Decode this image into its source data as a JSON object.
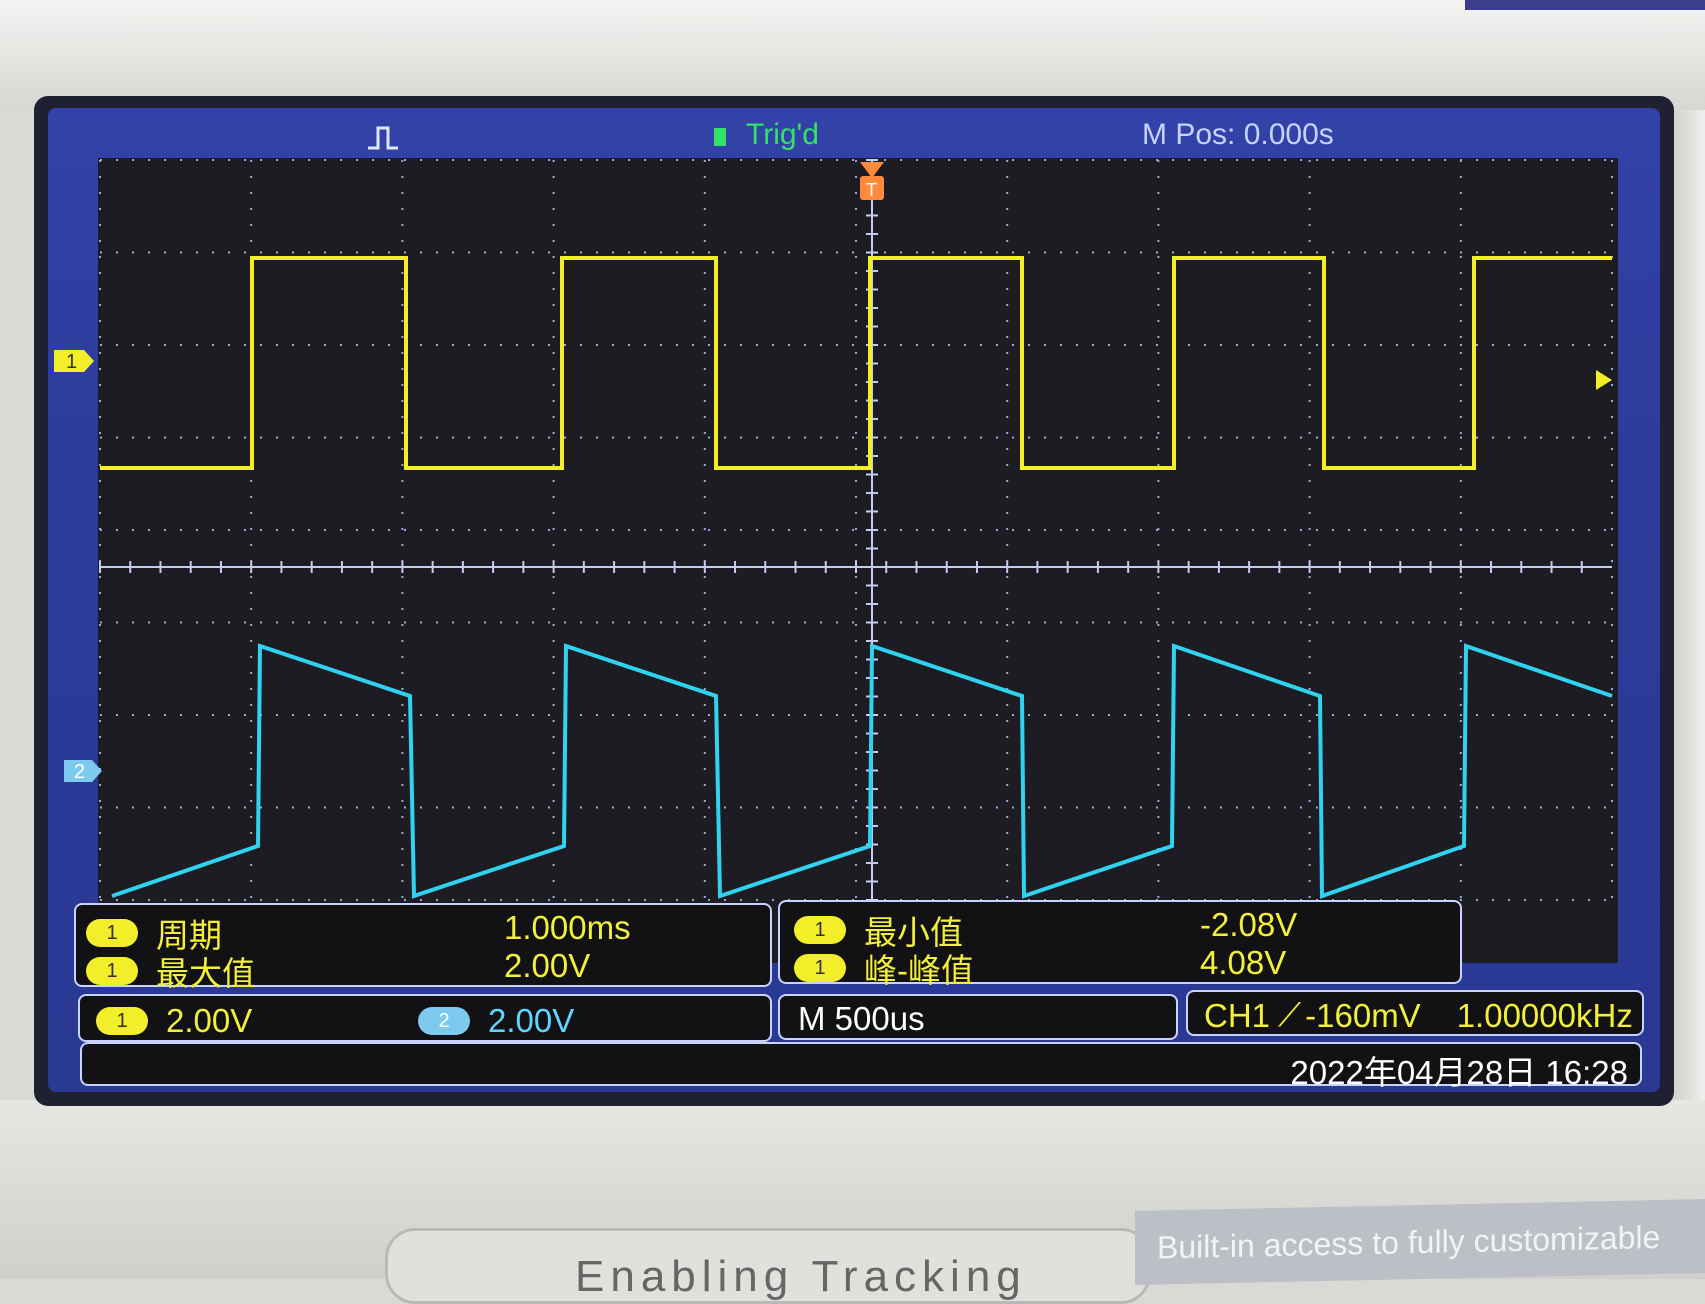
{
  "status_bar": {
    "trigger_state": "Trig'd",
    "position": "M Pos: 0.000s"
  },
  "markers": {
    "ch1_marker": "1",
    "ch2_marker": "2",
    "trigger_marker": "T"
  },
  "measurements": {
    "left": [
      {
        "channel": "1",
        "label": "周期",
        "value": "1.000ms"
      },
      {
        "channel": "1",
        "label": "最大值",
        "value": "2.00V"
      }
    ],
    "right": [
      {
        "channel": "1",
        "label": "最小值",
        "value": "-2.08V"
      },
      {
        "channel": "1",
        "label": "峰-峰值",
        "value": "4.08V"
      }
    ]
  },
  "scale_bar": {
    "ch1_label": "1",
    "ch1_scale": "2.00V",
    "ch2_label": "2",
    "ch2_scale": "2.00V",
    "timebase": "M 500us",
    "trigger_source": "CH1",
    "trigger_level": "-160mV",
    "frequency": "1.00000kHz"
  },
  "datetime": "2022年04月28日 16:28",
  "caption": "Built-in access to fully customizable",
  "bottom_text": "Enabling Tracking",
  "colors": {
    "ch1": "#f2ee2a",
    "ch2": "#2fd3f0",
    "screen": "#2c3a99",
    "plot_bg": "#1c1c22"
  }
}
